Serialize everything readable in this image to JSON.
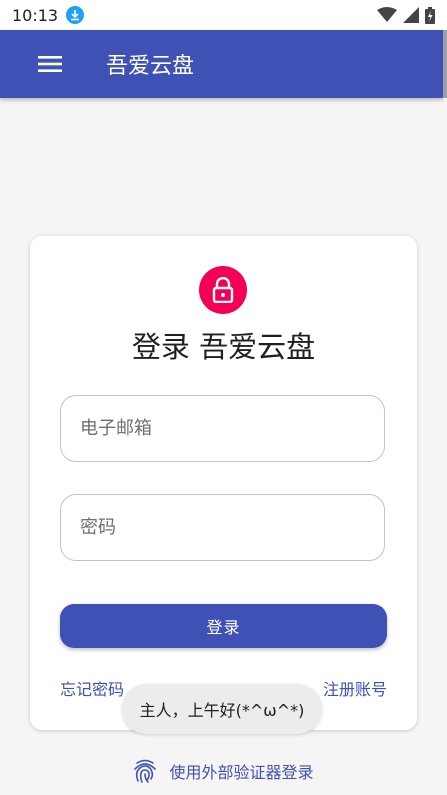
{
  "status_bar": {
    "time": "10:13",
    "icons": [
      "download-icon",
      "wifi-icon",
      "signal-icon",
      "battery-icon"
    ]
  },
  "app_bar": {
    "title": "吾爱云盘",
    "menu_icon": "hamburger-menu-icon",
    "color": "#3f51b5"
  },
  "login_card": {
    "lock_icon": "lock-icon",
    "title": "登录 吾爱云盘",
    "email": {
      "placeholder": "电子邮箱",
      "value": ""
    },
    "password": {
      "placeholder": "密码",
      "value": ""
    },
    "login_button": "登录",
    "forgot_password": "忘记密码",
    "register": "注册账号",
    "accent_color": "#f50057"
  },
  "toast": {
    "text": "主人，上午好(*^ω^*)"
  },
  "external_login": {
    "icon": "fingerprint-icon",
    "label": "使用外部验证器登录"
  }
}
